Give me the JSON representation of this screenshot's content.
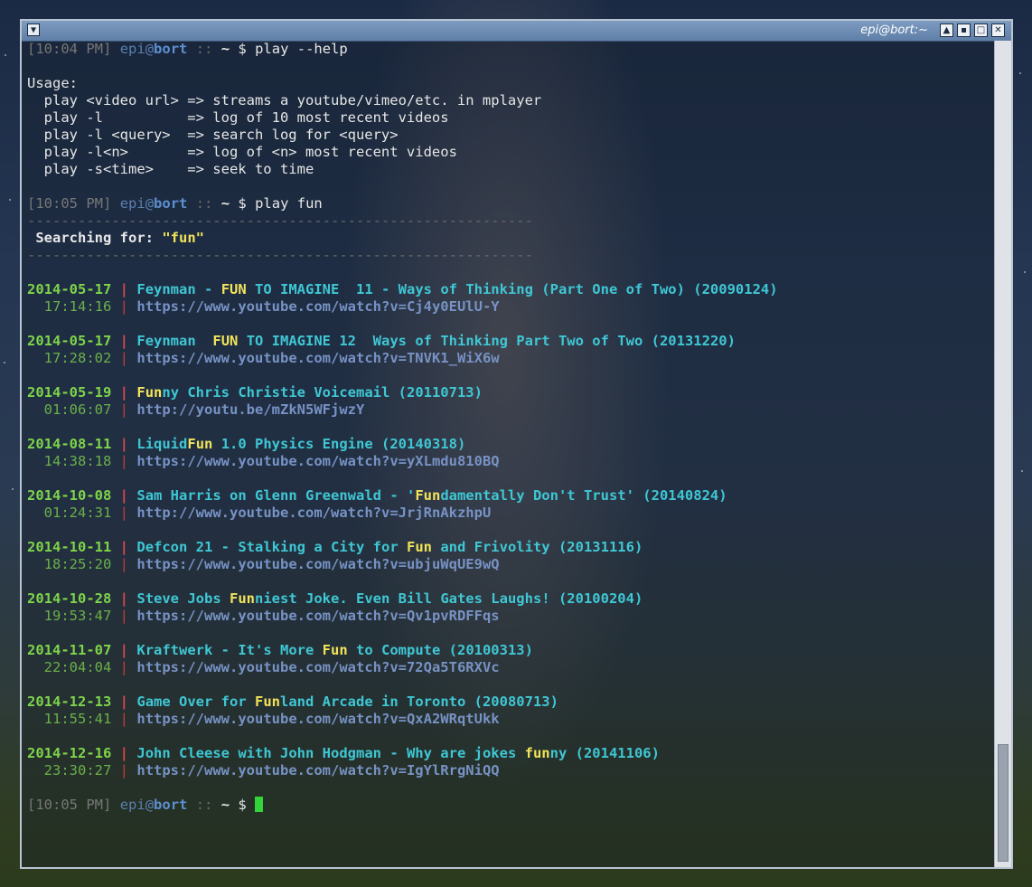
{
  "window": {
    "title": "epi@bort:~"
  },
  "prompts": {
    "p1": {
      "time": "10:04 PM",
      "user": "epi",
      "host": "bort",
      "sep": "::",
      "dir": "~",
      "dollar": "$",
      "command": "play --help"
    },
    "p2": {
      "time": "10:05 PM",
      "user": "epi",
      "host": "bort",
      "sep": "::",
      "dir": "~",
      "dollar": "$",
      "command": "play fun"
    },
    "p3": {
      "time": "10:05 PM",
      "user": "epi",
      "host": "bort",
      "sep": "::",
      "dir": "~",
      "dollar": "$"
    }
  },
  "help": {
    "heading": "Usage:",
    "lines": [
      "  play <video url> => streams a youtube/vimeo/etc. in mplayer",
      "  play -l          => log of 10 most recent videos",
      "  play -l <query>  => search log for <query>",
      "  play -l<n>       => log of <n> most recent videos",
      "  play -s<time>    => seek to time"
    ]
  },
  "search": {
    "separator": "------------------------------------------------------------",
    "label": "Searching for:",
    "query": "\"fun\""
  },
  "results": [
    {
      "date": "2014-05-17",
      "time": "17:14:16",
      "title_pre": "Feynman - ",
      "title_hl": "FUN",
      "title_post": " TO IMAGINE  11 - Ways of Thinking (Part One of Two) (20090124)",
      "url": "https://www.youtube.com/watch?v=Cj4y0EUlU-Y"
    },
    {
      "date": "2014-05-17",
      "time": "17:28:02",
      "title_pre": "Feynman  ",
      "title_hl": "FUN",
      "title_post": " TO IMAGINE 12  Ways of Thinking Part Two of Two (20131220)",
      "url": "https://www.youtube.com/watch?v=TNVK1_WiX6w"
    },
    {
      "date": "2014-05-19",
      "time": "01:06:07",
      "title_pre": "",
      "title_hl": "Fun",
      "title_post": "ny Chris Christie Voicemail (20110713)",
      "url": "http://youtu.be/mZkN5WFjwzY"
    },
    {
      "date": "2014-08-11",
      "time": "14:38:18",
      "title_pre": "Liquid",
      "title_hl": "Fun",
      "title_post": " 1.0 Physics Engine (20140318)",
      "url": "https://www.youtube.com/watch?v=yXLmdu810BQ"
    },
    {
      "date": "2014-10-08",
      "time": "01:24:31",
      "title_pre": "Sam Harris on Glenn Greenwald - '",
      "title_hl": "Fun",
      "title_post": "damentally Don't Trust' (20140824)",
      "url": "http://www.youtube.com/watch?v=JrjRnAkzhpU"
    },
    {
      "date": "2014-10-11",
      "time": "18:25:20",
      "title_pre": "Defcon 21 - Stalking a City for ",
      "title_hl": "Fun",
      "title_post": " and Frivolity (20131116)",
      "url": "https://www.youtube.com/watch?v=ubjuWqUE9wQ"
    },
    {
      "date": "2014-10-28",
      "time": "19:53:47",
      "title_pre": "Steve Jobs ",
      "title_hl": "Fun",
      "title_post": "niest Joke. Even Bill Gates Laughs! (20100204)",
      "url": "https://www.youtube.com/watch?v=Qv1pvRDFFqs"
    },
    {
      "date": "2014-11-07",
      "time": "22:04:04",
      "title_pre": "Kraftwerk - It's More ",
      "title_hl": "Fun",
      "title_post": " to Compute (20100313)",
      "url": "https://www.youtube.com/watch?v=72Qa5T6RXVc"
    },
    {
      "date": "2014-12-13",
      "time": "11:55:41",
      "title_pre": "Game Over for ",
      "title_hl": "Fun",
      "title_post": "land Arcade in Toronto (20080713)",
      "url": "https://www.youtube.com/watch?v=QxA2WRqtUkk"
    },
    {
      "date": "2014-12-16",
      "time": "23:30:27",
      "title_pre": "John Cleese with John Hodgman - Why are jokes ",
      "title_hl": "fun",
      "title_post": "ny (20141106)",
      "url": "https://www.youtube.com/watch?v=IgYlRrgNiQQ"
    }
  ],
  "colors": {
    "date": "#7ed44a",
    "pipe": "#e0454b",
    "title": "#3fc7d4",
    "highlight": "#f1e35a",
    "url": "#7792c4",
    "cursor": "#33d33a"
  }
}
